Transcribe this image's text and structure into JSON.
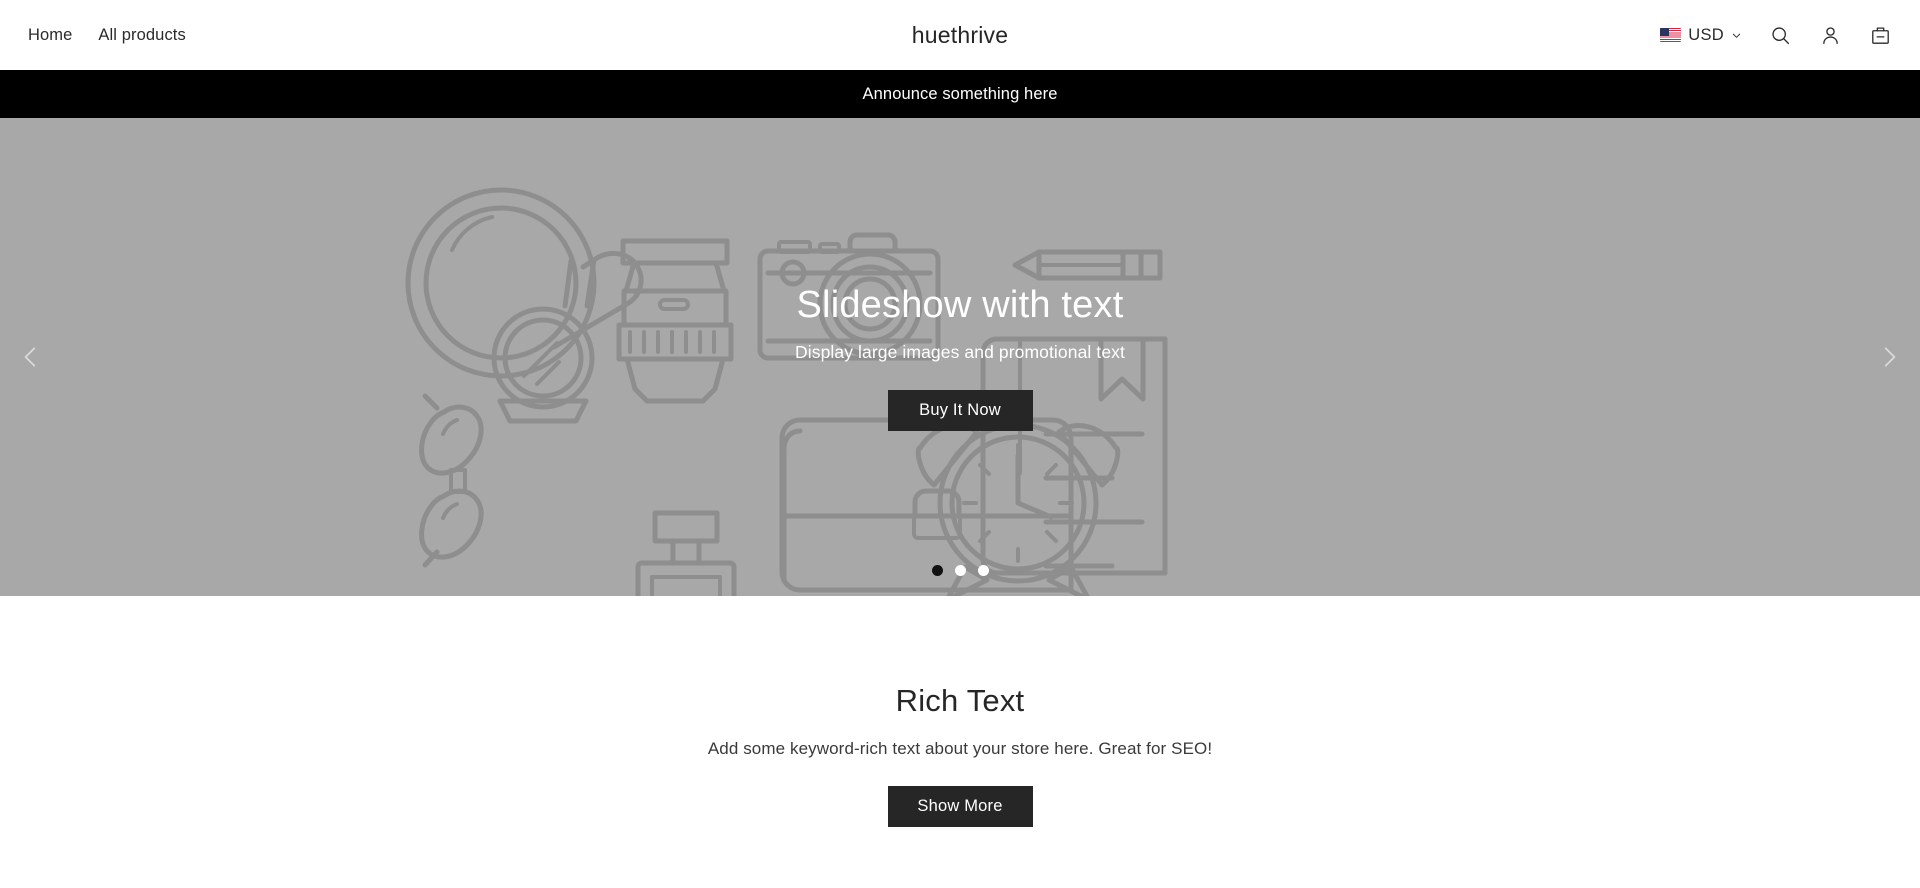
{
  "header": {
    "nav": [
      {
        "label": "Home",
        "name": "nav-link-home"
      },
      {
        "label": "All products",
        "name": "nav-link-all-products"
      }
    ],
    "logo": "huethrive",
    "currency": {
      "label": "USD",
      "flag": "us-flag-icon",
      "chevron": "chevron-down-icon"
    },
    "icons": [
      {
        "name": "search-icon",
        "label": "Search"
      },
      {
        "name": "account-icon",
        "label": "Account"
      },
      {
        "name": "cart-icon",
        "label": "Cart"
      }
    ]
  },
  "announcement": {
    "text": "Announce something here",
    "background": "#000000",
    "color": "#ffffff"
  },
  "slideshow": {
    "title": "Slideshow with text",
    "subtitle": "Display large images and promotional text",
    "button_label": "Buy It Now",
    "prev_label": "Previous slide",
    "next_label": "Next slide",
    "background": "#a8a8a8",
    "art_stroke": "#8e8e8e",
    "dots": [
      {
        "active": true
      },
      {
        "active": false
      },
      {
        "active": false
      }
    ]
  },
  "rich_text": {
    "title": "Rich Text",
    "subtitle": "Add some keyword-rich text about your store here. Great for SEO!",
    "button_label": "Show More"
  },
  "theme": {
    "accent_dark": "#262626",
    "page_background": "#ffffff",
    "text_color": "#262626"
  }
}
